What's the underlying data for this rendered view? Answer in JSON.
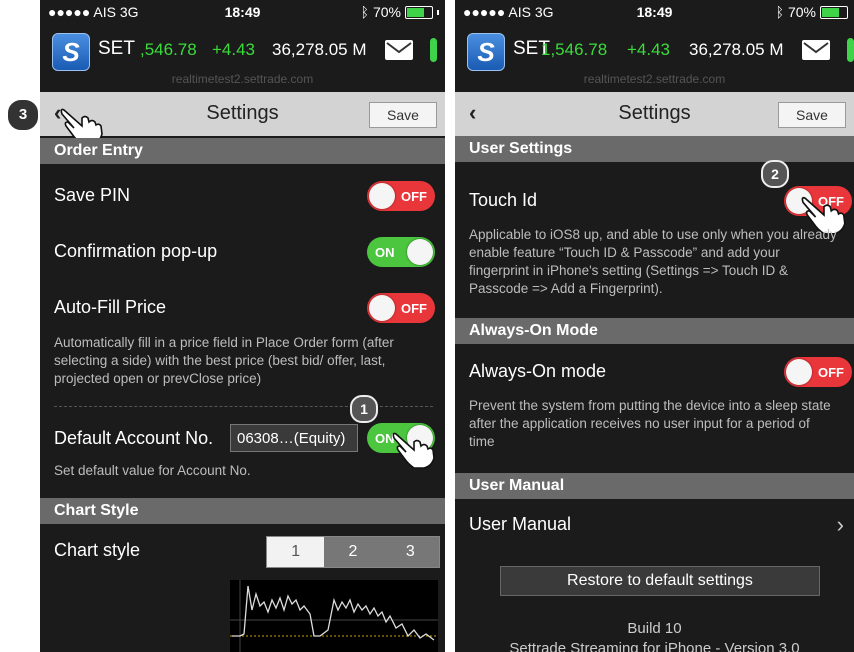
{
  "status_bar": {
    "carrier": "●●●●● AIS  3G",
    "time": "18:49",
    "battery": "70%"
  },
  "ticker": {
    "left": {
      "index": ",546.78",
      "change": "+4.43",
      "volume": "36,278.05 M"
    },
    "right": {
      "index": "1,546.78",
      "change": "+4.43",
      "volume": "36,278.05 M"
    },
    "logo_text": "SET",
    "domain": "realtimetest2.settrade.com"
  },
  "navbar": {
    "title": "Settings",
    "save_label": "Save",
    "back_symbol": "‹"
  },
  "left_screen": {
    "order_entry_header": "Order Entry",
    "save_pin_label": "Save PIN",
    "save_pin_state": "OFF",
    "confirmation_label": "Confirmation pop-up",
    "confirmation_state": "ON",
    "autofill_label": "Auto-Fill Price",
    "autofill_state": "OFF",
    "autofill_desc": "Automatically fill in a price field in Place Order form (after selecting a side) with the best price (best bid/ offer, last, projected open or prevClose price)",
    "default_account_label": "Default Account No.",
    "default_account_value": "06308…(Equity)",
    "default_account_state": "ON",
    "default_account_desc": "Set default value for Account No.",
    "chart_style_header": "Chart Style",
    "chart_style_label": "Chart style",
    "chart_style_options": [
      "1",
      "2",
      "3"
    ],
    "chart_style_selected": "1"
  },
  "right_screen": {
    "user_settings_header": "User Settings",
    "touch_id_label": "Touch Id",
    "touch_id_state": "OFF",
    "touch_id_desc": "Applicable to iOS8 up, and able to use only when you already enable feature “Touch ID & Passcode” and add your fingerprint in iPhone's setting (Settings => Touch ID & Passcode => Add a Fingerprint).",
    "always_on_header": "Always-On Mode",
    "always_on_label": "Always-On mode",
    "always_on_state": "OFF",
    "always_on_desc": "Prevent the system from putting the device into a sleep state after the application receives no user input for a period of time",
    "user_manual_header": "User Manual",
    "user_manual_label": "User Manual",
    "restore_label": "Restore to default settings",
    "build_text": "Build 10",
    "version_text": "Settrade Streaming for iPhone - Version 3.0"
  },
  "annotations": {
    "step1": "1",
    "step2": "2",
    "step3": "3"
  },
  "colors": {
    "toggle_on": "#4cc63f",
    "toggle_off": "#e9363a",
    "ticker_green": "#3bdb3b",
    "section_header": "#6a6a6a",
    "navbar": "#d3d3d3"
  },
  "icons": [
    "bluetooth-icon",
    "battery-icon",
    "mail-icon",
    "back-chevron-icon",
    "pointing-hand-icon",
    "chevron-right-icon"
  ]
}
